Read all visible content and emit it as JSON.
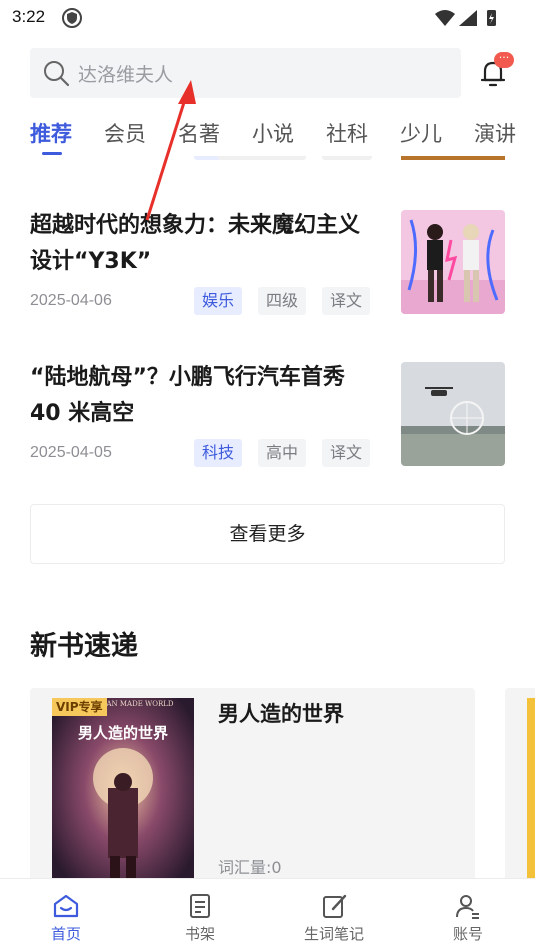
{
  "status_bar": {
    "time": "3:22"
  },
  "search": {
    "placeholder": "达洛维夫人"
  },
  "notification": {
    "badge": "···"
  },
  "tabs": [
    {
      "label": "推荐",
      "active": true
    },
    {
      "label": "会员"
    },
    {
      "label": "名著"
    },
    {
      "label": "小说"
    },
    {
      "label": "社科"
    },
    {
      "label": "少儿"
    },
    {
      "label": "演讲"
    }
  ],
  "articles": [
    {
      "title": "超越时代的想象力：未来魔幻主义设计“Y3K”",
      "date": "2025-04-06",
      "tags": [
        "娱乐",
        "四级",
        "译文"
      ]
    },
    {
      "title": "“陆地航母”？小鹏飞行汽车首秀 40 米高空",
      "date": "2025-04-05",
      "tags": [
        "科技",
        "高中",
        "译文"
      ]
    }
  ],
  "more_button": "查看更多",
  "new_books": {
    "section_title": "新书速递",
    "books": [
      {
        "vip": "VIP专享",
        "cover_title": "男人造的世界",
        "cover_subtitle": "AN MADE WORLD",
        "title": "男人造的世界",
        "words": "词汇量:0"
      }
    ]
  },
  "bottom_nav": [
    {
      "label": "首页",
      "icon": "home-icon",
      "active": true
    },
    {
      "label": "书架",
      "icon": "bookshelf-icon"
    },
    {
      "label": "生词笔记",
      "icon": "edit-note-icon"
    },
    {
      "label": "账号",
      "icon": "account-icon"
    }
  ],
  "colors": {
    "accent": "#3d5bdc",
    "badge": "#f25a4f",
    "vip": "#f6c75a",
    "annotation": "#e8302a"
  }
}
